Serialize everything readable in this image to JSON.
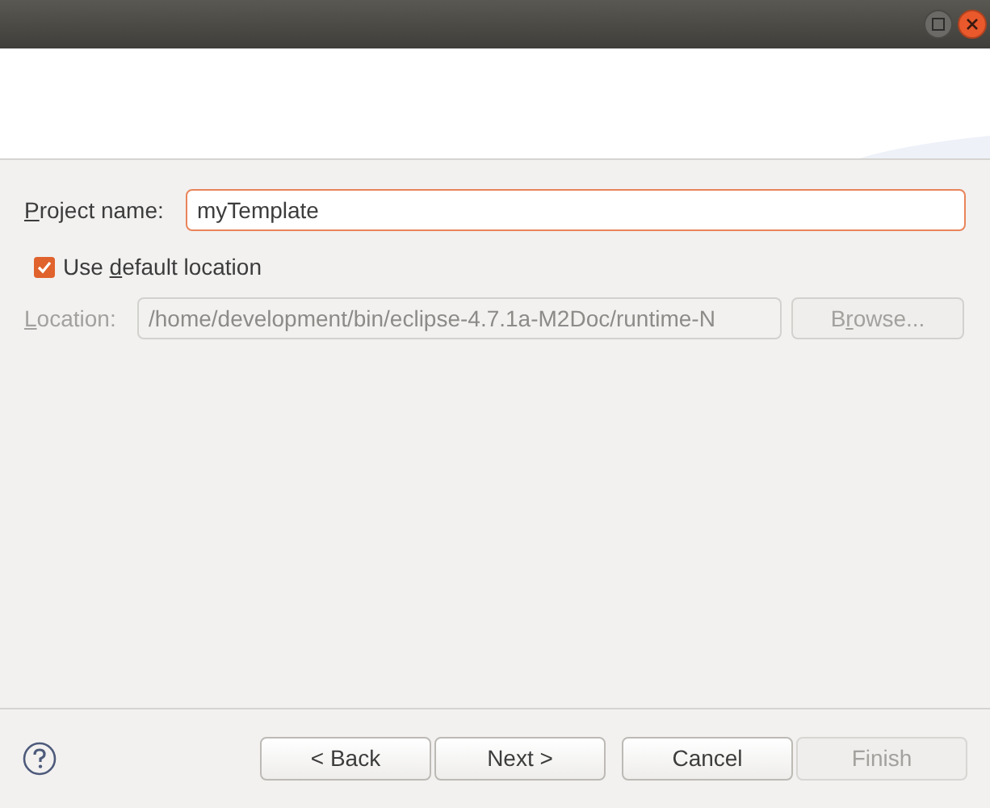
{
  "window": {
    "buttons": [
      {
        "kind": "maximize"
      },
      {
        "kind": "close"
      }
    ]
  },
  "project_name": {
    "label": {
      "key": "P",
      "after": "roject name:"
    },
    "value": "myTemplate",
    "focused": true
  },
  "use_default_location": {
    "label": {
      "before": "Use ",
      "key": "d",
      "after": "efault location"
    },
    "checked": true
  },
  "location": {
    "label": {
      "key": "L",
      "after": "ocation:"
    },
    "value": "/home/development/bin/eclipse-4.7.1a-M2Doc/runtime-N",
    "disabled": true
  },
  "browse_button": {
    "label": {
      "before": "B",
      "key": "r",
      "after": "owse..."
    },
    "disabled": true
  },
  "buttons": [
    {
      "label": "< Back",
      "disabled": false
    },
    {
      "label": "Next >",
      "disabled": false
    },
    {
      "label": "Cancel",
      "disabled": false
    },
    {
      "label": "Finish",
      "disabled": true
    }
  ]
}
